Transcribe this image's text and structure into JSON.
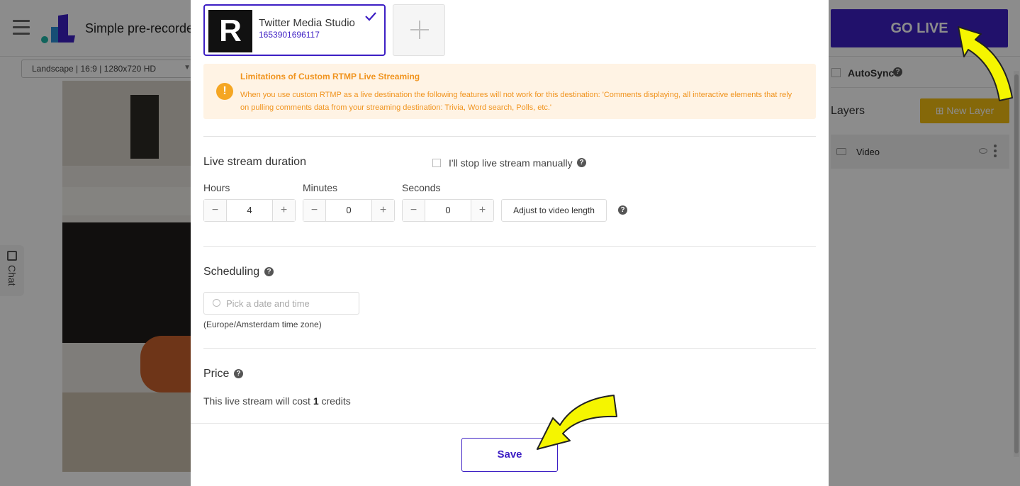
{
  "app": {
    "title": "Simple pre-recorde",
    "format_select": "Landscape | 16:9 | 1280x720 HD",
    "chat_label": "Chat",
    "go_live": "GO LIVE",
    "autosync_label": "AutoSync",
    "layers_title": "Layers",
    "new_layer_label": "New Layer",
    "layers": [
      {
        "label": "Video"
      }
    ]
  },
  "modal": {
    "destination": {
      "logo_letter": "R",
      "name": "Twitter Media Studio",
      "id": "1653901696117"
    },
    "warning": {
      "title": "Limitations of Custom RTMP Live Streaming",
      "text": "When you use custom RTMP as a live destination the following features will not work for this destination: 'Comments displaying, all interactive elements that rely on pulling comments data from your streaming destination: Trivia, Word search, Polls, etc.'"
    },
    "duration": {
      "title": "Live stream duration",
      "manual_label": "I'll stop live stream manually",
      "hours_label": "Hours",
      "minutes_label": "Minutes",
      "seconds_label": "Seconds",
      "hours": "4",
      "minutes": "0",
      "seconds": "0",
      "adjust_label": "Adjust to video length"
    },
    "scheduling": {
      "title": "Scheduling",
      "placeholder": "Pick a date and time",
      "timezone": "(Europe/Amsterdam time zone)"
    },
    "price": {
      "title": "Price",
      "text_before": "This live stream will cost ",
      "credits": "1",
      "text_after": " credits"
    },
    "save_label": "Save"
  },
  "colors": {
    "accent": "#3d1fc4",
    "warning": "#f0931d",
    "new_layer": "#f3bd12",
    "annotation_arrow": "#f5f500"
  }
}
